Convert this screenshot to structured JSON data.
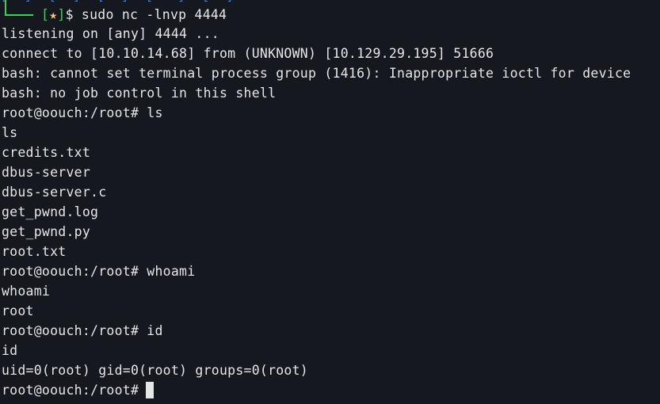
{
  "terminal": {
    "top_fragment": "[  ]  [  ]  [  ]  [   ]  [  ]",
    "prompt": {
      "open_bracket": "[",
      "star": "★",
      "close_bracket": "]",
      "symbol": "$",
      "command": " sudo nc -lnvp 4444"
    },
    "lines": [
      "listening on [any] 4444 ...",
      "connect to [10.10.14.68] from (UNKNOWN) [10.129.29.195] 51666",
      "bash: cannot set terminal process group (1416): Inappropriate ioctl for device",
      "bash: no job control in this shell",
      "root@oouch:/root# ls",
      "ls",
      "credits.txt",
      "dbus-server",
      "dbus-server.c",
      "get_pwnd.log",
      "get_pwnd.py",
      "root.txt",
      "root@oouch:/root# whoami",
      "whoami",
      "root",
      "root@oouch:/root# id",
      "id",
      "uid=0(root) gid=0(root) groups=0(root)"
    ],
    "current_prompt": "root@oouch:/root#"
  },
  "colors": {
    "background": "#16181f",
    "foreground": "#e6e6e6",
    "prompt_green": "#39d353",
    "star_yellow": "#f0c674"
  },
  "icons": {
    "cursor": "block-cursor-icon"
  }
}
